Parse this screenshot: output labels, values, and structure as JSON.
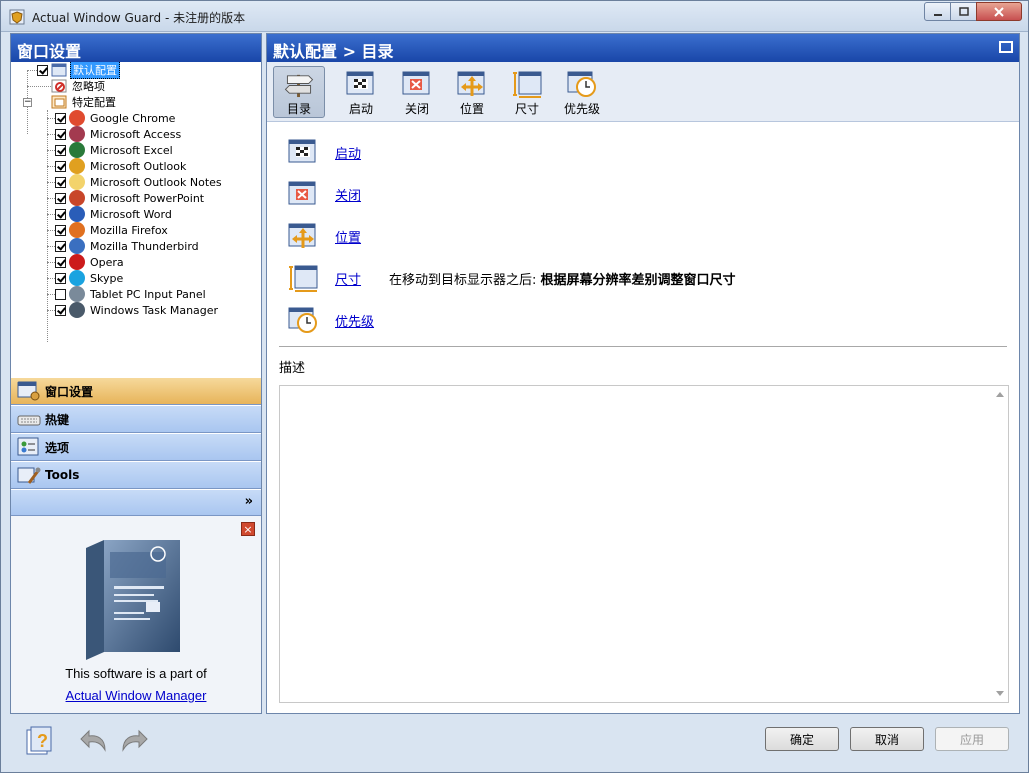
{
  "window": {
    "title": "Actual Window Guard - 未注册的版本"
  },
  "left": {
    "header": "窗口设置",
    "tree": {
      "default": "默认配置",
      "ignore": "忽略项",
      "specific": "特定配置",
      "apps": [
        {
          "label": "Google Chrome",
          "checked": true,
          "color": "#e04b2f"
        },
        {
          "label": "Microsoft Access",
          "checked": true,
          "color": "#a33a4f"
        },
        {
          "label": "Microsoft Excel",
          "checked": true,
          "color": "#2a7a3a"
        },
        {
          "label": "Microsoft Outlook",
          "checked": true,
          "color": "#e0a020"
        },
        {
          "label": "Microsoft Outlook Notes",
          "checked": true,
          "color": "#f3d36b"
        },
        {
          "label": "Microsoft PowerPoint",
          "checked": true,
          "color": "#c8462a"
        },
        {
          "label": "Microsoft Word",
          "checked": true,
          "color": "#2a5db8"
        },
        {
          "label": "Mozilla Firefox",
          "checked": true,
          "color": "#e07020"
        },
        {
          "label": "Mozilla Thunderbird",
          "checked": true,
          "color": "#3a6fc0"
        },
        {
          "label": "Opera",
          "checked": true,
          "color": "#cc1b1b"
        },
        {
          "label": "Skype",
          "checked": true,
          "color": "#1aa3e0"
        },
        {
          "label": "Tablet PC Input Panel",
          "checked": false,
          "color": "#7a8a9a"
        },
        {
          "label": "Windows Task Manager",
          "checked": true,
          "color": "#4a5a6a"
        }
      ]
    },
    "nav": [
      {
        "label": "窗口设置",
        "active": true
      },
      {
        "label": "热键",
        "active": false
      },
      {
        "label": "选项",
        "active": false
      },
      {
        "label": "Tools",
        "active": false
      }
    ],
    "more": "»",
    "promo": {
      "text": "This software is a part of",
      "link": "Actual Window Manager",
      "box_title": "Actual Window Manager",
      "close": "×"
    }
  },
  "right": {
    "header": "默认配置 > 目录",
    "toolbar": [
      "目录",
      "启动",
      "关闭",
      "位置",
      "尺寸",
      "优先级"
    ],
    "links": [
      {
        "label": "启动",
        "desc_prefix": "",
        "desc_bold": ""
      },
      {
        "label": "关闭",
        "desc_prefix": "",
        "desc_bold": ""
      },
      {
        "label": "位置",
        "desc_prefix": "",
        "desc_bold": ""
      },
      {
        "label": "尺寸",
        "desc_prefix": "在移动到目标显示器之后: ",
        "desc_bold": "根据屏幕分辨率差别调整窗口尺寸"
      },
      {
        "label": "优先级",
        "desc_prefix": "",
        "desc_bold": ""
      }
    ],
    "description_label": "描述",
    "description_text": ""
  },
  "buttons": {
    "ok": "确定",
    "cancel": "取消",
    "apply": "应用"
  },
  "colors": {
    "header_blue": "#1946a8",
    "link": "#0000cc",
    "active_nav": "#e7b45a"
  }
}
